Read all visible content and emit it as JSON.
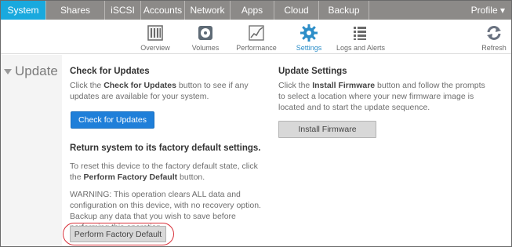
{
  "topnav": {
    "tabs": [
      {
        "label": "System",
        "active": true
      },
      {
        "label": "Shares"
      },
      {
        "label": "iSCSI"
      },
      {
        "label": "Accounts"
      },
      {
        "label": "Network"
      },
      {
        "label": "Apps"
      },
      {
        "label": "Cloud"
      },
      {
        "label": "Backup"
      }
    ],
    "profile_label": "Profile ▾"
  },
  "subnav": {
    "items": [
      {
        "label": "Overview",
        "icon": "overview-icon"
      },
      {
        "label": "Volumes",
        "icon": "volumes-icon"
      },
      {
        "label": "Performance",
        "icon": "performance-icon"
      },
      {
        "label": "Settings",
        "icon": "gear-icon",
        "active": true
      },
      {
        "label": "Logs and Alerts",
        "icon": "logs-icon"
      },
      {
        "label": "Refresh",
        "icon": "refresh-icon"
      }
    ]
  },
  "section": {
    "title": "Update"
  },
  "check_updates": {
    "heading": "Check for Updates",
    "desc_pre": "Click the ",
    "desc_bold": "Check for Updates",
    "desc_post": " button to see if any updates are available for your system.",
    "button_label": "Check for Updates"
  },
  "update_settings": {
    "heading": "Update Settings",
    "desc_pre": "Click the ",
    "desc_bold": "Install Firmware",
    "desc_post": " button and follow the prompts to select a location where your new firmware image is located and to start the update sequence.",
    "button_label": "Install Firmware"
  },
  "factory_default": {
    "heading": "Return system to its factory default settings.",
    "desc_pre": "To reset this device to the factory default state, click the ",
    "desc_bold": "Perform Factory Default",
    "desc_post": " button.",
    "warning": "WARNING: This operation clears ALL data and configuration on this device, with no recovery option. Backup any data that you wish to save before performing this operation.",
    "button_label": "Perform Factory Default"
  },
  "colors": {
    "accent": "#19a9de",
    "primary_button": "#1f7fd9",
    "nav_bg": "#8c8a88",
    "highlight": "#d8323a"
  }
}
